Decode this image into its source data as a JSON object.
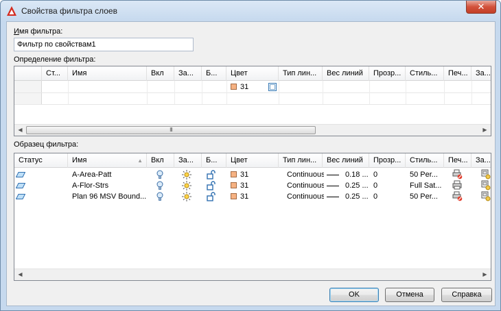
{
  "window": {
    "title": "Свойства фильтра слоев",
    "close_label": "✕"
  },
  "filter_name": {
    "label_underlined": "И",
    "label_rest": "мя фильтра:",
    "value": "Фильтр по свойствам1"
  },
  "definition": {
    "label": "Определение фильтра:",
    "columns": [
      "Ст...",
      "Имя",
      "Вкл",
      "За...",
      "Б...",
      "Цвет",
      "Тип лин...",
      "Вес линий",
      "Прозр...",
      "Стиль...",
      "Печ...",
      "За..."
    ],
    "row": {
      "color_value": "31"
    }
  },
  "preview": {
    "label": "Образец фильтра:",
    "columns": [
      "Статус",
      "Имя",
      "Вкл",
      "За...",
      "Б...",
      "Цвет",
      "Тип лин...",
      "Вес линий",
      "Прозр...",
      "Стиль...",
      "Печ...",
      "За..."
    ],
    "rows": [
      {
        "name": "A-Area-Patt",
        "color": "31",
        "linetype": "Continuous",
        "lineweight": "0.18 ...",
        "transparency": "0",
        "plot_style": "50 Per..."
      },
      {
        "name": "A-Flor-Strs",
        "color": "31",
        "linetype": "Continuous",
        "lineweight": "0.25 ...",
        "transparency": "0",
        "plot_style": "Full Sat..."
      },
      {
        "name": "Plan 96 MSV Bound...",
        "color": "31",
        "linetype": "Continuous",
        "lineweight": "0.25 ...",
        "transparency": "0",
        "plot_style": "50 Per..."
      }
    ]
  },
  "buttons": {
    "ok": "OK",
    "cancel": "Отмена",
    "help": "Справка"
  },
  "colors": {
    "accent_swatch": "#f6b283",
    "title_bg": "#c6d9ee",
    "close": "#c33f27"
  }
}
